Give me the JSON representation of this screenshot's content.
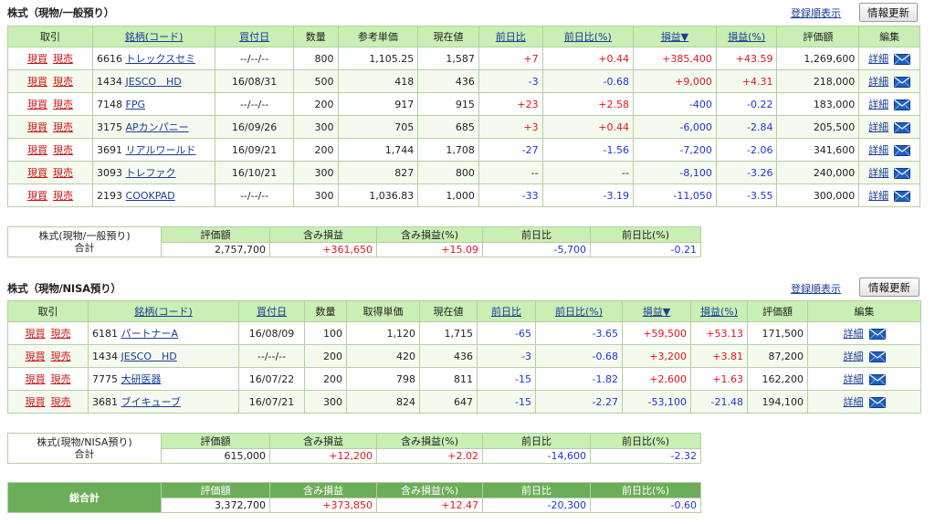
{
  "general": {
    "title": "株式（現物/一般預り）",
    "sort_link": "登録順表示",
    "refresh": "情報更新",
    "headers": [
      "取引",
      "銘柄(コード)",
      "買付日",
      "数量",
      "参考単価",
      "現在値",
      "前日比",
      "前日比(%)",
      "損益▼",
      "損益(%)",
      "評価額",
      "編集"
    ],
    "rows": [
      {
        "code": "6616",
        "name": "トレックスセミ",
        "date": "--/--/--",
        "qty": "800",
        "price": "1,105.25",
        "current": "1,587",
        "chg": "+7",
        "chg_pct": "+0.44",
        "pl": "+385,400",
        "pl_pct": "+43.59",
        "value": "1,269,600"
      },
      {
        "code": "1434",
        "name": "JESCO　HD",
        "date": "16/08/31",
        "qty": "500",
        "price": "418",
        "current": "436",
        "chg": "-3",
        "chg_pct": "-0.68",
        "pl": "+9,000",
        "pl_pct": "+4.31",
        "value": "218,000"
      },
      {
        "code": "7148",
        "name": "FPG",
        "date": "--/--/--",
        "qty": "200",
        "price": "917",
        "current": "915",
        "chg": "+23",
        "chg_pct": "+2.58",
        "pl": "-400",
        "pl_pct": "-0.22",
        "value": "183,000"
      },
      {
        "code": "3175",
        "name": "APカンパニー",
        "date": "16/09/26",
        "qty": "300",
        "price": "705",
        "current": "685",
        "chg": "+3",
        "chg_pct": "+0.44",
        "pl": "-6,000",
        "pl_pct": "-2.84",
        "value": "205,500"
      },
      {
        "code": "3691",
        "name": "リアルワールド",
        "date": "16/09/21",
        "qty": "200",
        "price": "1,744",
        "current": "1,708",
        "chg": "-27",
        "chg_pct": "-1.56",
        "pl": "-7,200",
        "pl_pct": "-2.06",
        "value": "341,600"
      },
      {
        "code": "3093",
        "name": "トレファク",
        "date": "16/10/21",
        "qty": "300",
        "price": "827",
        "current": "800",
        "chg": "--",
        "chg_pct": "--",
        "pl": "-8,100",
        "pl_pct": "-3.26",
        "value": "240,000"
      },
      {
        "code": "2193",
        "name": "COOKPAD",
        "date": "--/--/--",
        "qty": "300",
        "price": "1,036.83",
        "current": "1,000",
        "chg": "-33",
        "chg_pct": "-3.19",
        "pl": "-11,050",
        "pl_pct": "-3.55",
        "value": "300,000"
      }
    ],
    "summary": {
      "label1": "株式(現物/一般預り)",
      "label2": "合計",
      "headers": [
        "評価額",
        "含み損益",
        "含み損益(%)",
        "前日比",
        "前日比(%)"
      ],
      "values": [
        "2,757,700",
        "+361,650",
        "+15.09",
        "-5,700",
        "-0.21"
      ]
    }
  },
  "nisa": {
    "title": "株式（現物/NISA預り）",
    "sort_link": "登録順表示",
    "refresh": "情報更新",
    "headers": [
      "取引",
      "銘柄(コード)",
      "買付日",
      "数量",
      "取得単価",
      "現在値",
      "前日比",
      "前日比(%)",
      "損益▼",
      "損益(%)",
      "評価額",
      "編集"
    ],
    "rows": [
      {
        "code": "6181",
        "name": "パートナーA",
        "date": "16/08/09",
        "qty": "100",
        "price": "1,120",
        "current": "1,715",
        "chg": "-65",
        "chg_pct": "-3.65",
        "pl": "+59,500",
        "pl_pct": "+53.13",
        "value": "171,500"
      },
      {
        "code": "1434",
        "name": "JESCO　HD",
        "date": "--/--/--",
        "qty": "200",
        "price": "420",
        "current": "436",
        "chg": "-3",
        "chg_pct": "-0.68",
        "pl": "+3,200",
        "pl_pct": "+3.81",
        "value": "87,200"
      },
      {
        "code": "7775",
        "name": "大研医器",
        "date": "16/07/22",
        "qty": "200",
        "price": "798",
        "current": "811",
        "chg": "-15",
        "chg_pct": "-1.82",
        "pl": "+2,600",
        "pl_pct": "+1.63",
        "value": "162,200"
      },
      {
        "code": "3681",
        "name": "ブイキューブ",
        "date": "16/07/21",
        "qty": "300",
        "price": "824",
        "current": "647",
        "chg": "-15",
        "chg_pct": "-2.27",
        "pl": "-53,100",
        "pl_pct": "-21.48",
        "value": "194,100"
      }
    ],
    "summary": {
      "label1": "株式(現物/NISA預り)",
      "label2": "合計",
      "headers": [
        "評価額",
        "含み損益",
        "含み損益(%)",
        "前日比",
        "前日比(%)"
      ],
      "values": [
        "615,000",
        "+12,200",
        "+2.02",
        "-14,600",
        "-2.32"
      ]
    }
  },
  "total": {
    "label": "総合計",
    "headers": [
      "評価額",
      "含み損益",
      "含み損益(%)",
      "前日比",
      "前日比(%)"
    ],
    "values": [
      "3,372,700",
      "+373,850",
      "+12.47",
      "-20,300",
      "-0.60"
    ]
  },
  "actions": {
    "buy": "現買",
    "sell": "現売",
    "detail": "詳細",
    "mail_icon": "mail-icon"
  },
  "colors": {
    "header_bg": "#c9efb4",
    "total_bg": "#6cad5a",
    "positive": "#e8151b",
    "negative": "#1f35d6",
    "link": "#1a3d99"
  }
}
